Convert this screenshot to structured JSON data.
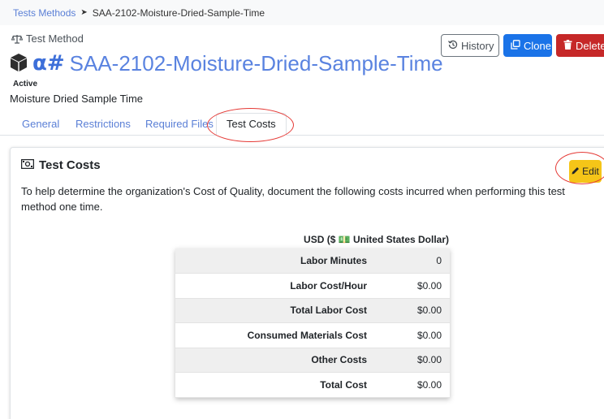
{
  "breadcrumb": {
    "parent": "Tests Methods",
    "current": "SAA-2102-Moisture-Dried-Sample-Time"
  },
  "header": {
    "type_label": "Test Method",
    "alpha_prefix": "α#",
    "title": "SAA-2102-Moisture-Dried-Sample-Time",
    "status": "Active",
    "description": "Moisture Dried Sample Time"
  },
  "actions": {
    "history": "History",
    "clone": "Clone",
    "delete": "Delete"
  },
  "tabs": [
    {
      "label": "General",
      "active": false
    },
    {
      "label": "Restrictions",
      "active": false
    },
    {
      "label": "Required Files",
      "active": false
    },
    {
      "label": "Test Costs",
      "active": true
    }
  ],
  "card": {
    "title": "Test Costs",
    "edit_label": "Edit",
    "text": "To help determine the organization's Cost of Quality, document the following costs incurred when performing this test method one time.",
    "currency": "USD ($ 💵 United States Dollar)",
    "rows": [
      {
        "label": "Labor Minutes",
        "value": "0"
      },
      {
        "label": "Labor Cost/Hour",
        "value": "$0.00"
      },
      {
        "label": "Total Labor Cost",
        "value": "$0.00"
      },
      {
        "label": "Consumed Materials Cost",
        "value": "$0.00"
      },
      {
        "label": "Other Costs",
        "value": "$0.00"
      },
      {
        "label": "Total Cost",
        "value": "$0.00"
      }
    ]
  },
  "colors": {
    "link": "#5a7fd6",
    "title": "#5a83e0",
    "clone": "#1a73e8",
    "delete": "#c62828",
    "edit": "#f5c518",
    "annotation": "#e53935"
  }
}
